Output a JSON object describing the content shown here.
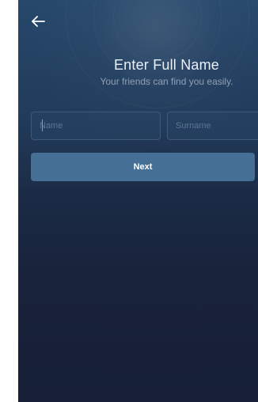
{
  "header": {
    "back_icon": "arrow-left-icon"
  },
  "content": {
    "title": "Enter Full Name",
    "subtitle": "Your friends can find you easily."
  },
  "form": {
    "first_name": {
      "value": "",
      "placeholder": "Name"
    },
    "last_name": {
      "value": "",
      "placeholder": "Surname"
    },
    "next_label": "Next"
  },
  "colors": {
    "background_top": "#27486b",
    "background_bottom": "#161f35",
    "button": "#466f96",
    "caret": "#5aa7ff"
  }
}
